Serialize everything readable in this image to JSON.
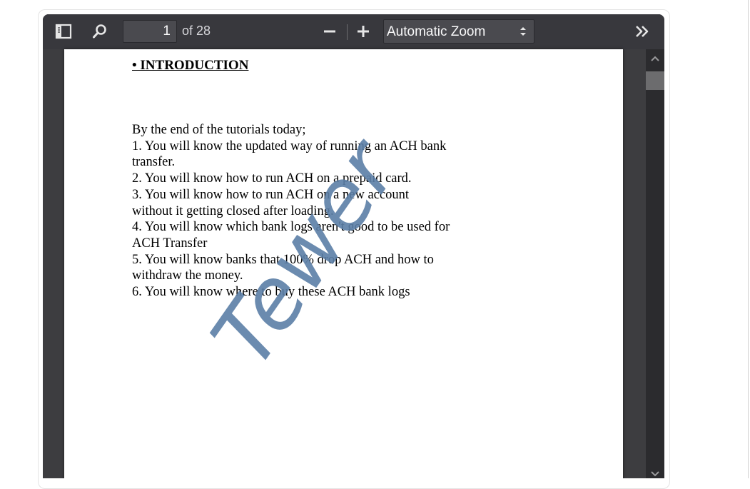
{
  "toolbar": {
    "page_number": "1",
    "page_count": "of 28",
    "zoom_value": "Automatic Zoom",
    "icons": {
      "sidebar": "sidebar-toggle-icon",
      "search": "search-icon",
      "zoom_out": "minus-icon",
      "zoom_in": "plus-icon",
      "zoom_dropdown": "updown-arrows-icon",
      "tools": "double-chevron-right-icon"
    }
  },
  "document": {
    "heading": "• INTRODUCTION",
    "lines": [
      "By the end of the tutorials today;",
      "1. You will know the updated way of running an ACH bank",
      "transfer.",
      "2. You will know how to run ACH on a prepaid card.",
      "3. You will know how to run ACH on a new account",
      "without it getting closed after loading.",
      "4. You will know which bank logs aren't good to be used for",
      "ACH Transfer",
      "5. You will know banks that 100% drop ACH and how to",
      "withdraw the money.",
      "6. You will know where to buy these ACH bank logs"
    ],
    "watermark": "Tewer"
  },
  "colors": {
    "toolbar_bg": "#38383d",
    "viewer_bg": "#3d3d40",
    "watermark": "#5b7ea6"
  }
}
